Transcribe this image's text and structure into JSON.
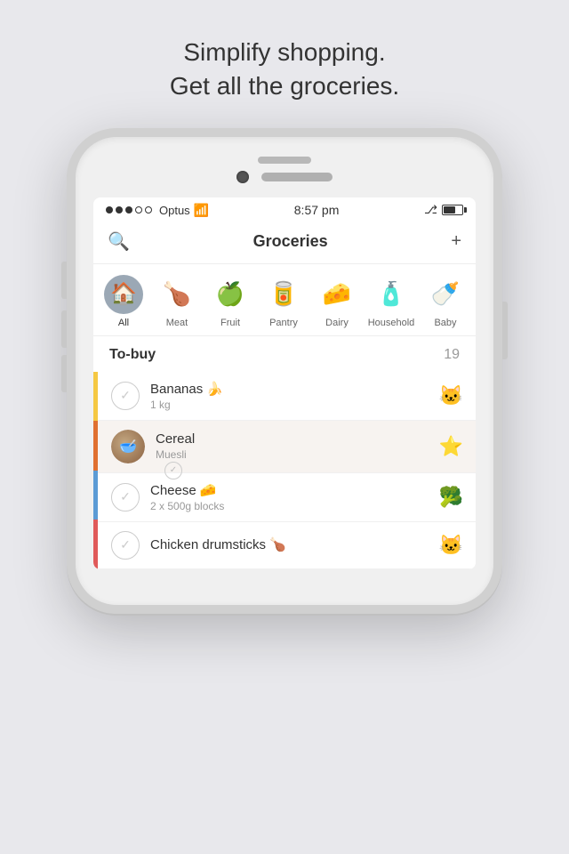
{
  "tagline": {
    "line1": "Simplify shopping.",
    "line2": "Get all the groceries."
  },
  "status_bar": {
    "signal_dots": 3,
    "carrier": "Optus",
    "time": "8:57 pm",
    "bluetooth": "⌁",
    "battery_pct": 65
  },
  "nav": {
    "title": "Groceries",
    "search_label": "🔍",
    "add_label": "+"
  },
  "categories": [
    {
      "id": "all",
      "label": "All",
      "icon": "🏠",
      "active": true
    },
    {
      "id": "meat",
      "label": "Meat",
      "icon": "🍗",
      "active": false
    },
    {
      "id": "fruit",
      "label": "Fruit",
      "icon": "🍏",
      "active": false
    },
    {
      "id": "pantry",
      "label": "Pantry",
      "icon": "🥫",
      "active": false
    },
    {
      "id": "dairy",
      "label": "Dairy",
      "icon": "🧀",
      "active": false
    },
    {
      "id": "household",
      "label": "Household",
      "icon": "🧴",
      "active": false
    },
    {
      "id": "baby",
      "label": "Baby",
      "icon": "🍼",
      "active": false
    }
  ],
  "section": {
    "title": "To-buy",
    "count": "19"
  },
  "items": [
    {
      "name": "Bananas 🍌",
      "sub": "1 kg",
      "emoji": "🐱",
      "checked": false,
      "highlighted": false,
      "has_thumb": false,
      "strip_color": "#f5c842"
    },
    {
      "name": "Cereal",
      "sub": "Muesli",
      "emoji": "⭐",
      "checked": true,
      "highlighted": true,
      "has_thumb": true,
      "strip_color": "#e07030"
    },
    {
      "name": "Cheese 🧀",
      "sub": "2 x 500g blocks",
      "emoji": "🥦",
      "checked": false,
      "highlighted": false,
      "has_thumb": false,
      "strip_color": "#5b9bd5"
    },
    {
      "name": "Chicken drumsticks 🍗",
      "sub": "",
      "emoji": "🐱",
      "checked": false,
      "highlighted": false,
      "has_thumb": false,
      "strip_color": "#e05a5a"
    }
  ],
  "colors": {
    "strip_segments": [
      "#f5c842",
      "#e07030",
      "#5b9bd5",
      "#e05a5a"
    ]
  }
}
